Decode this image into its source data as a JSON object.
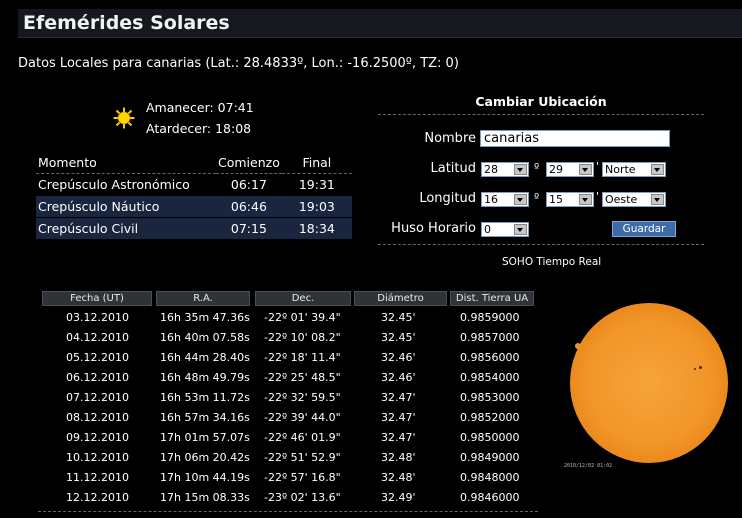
{
  "title": "Efemérides Solares",
  "location_line": "Datos Locales para canarias (Lat.: 28.4833º, Lon.: -16.2500º, TZ: 0)",
  "sun": {
    "sunrise": "Amanecer: 07:41",
    "sunset": "Atardecer: 18:08",
    "icon": "sun-icon"
  },
  "twilight": {
    "headers": [
      "Momento",
      "Comienzo",
      "Final"
    ],
    "rows": [
      {
        "name": "Crepúsculo Astronómico",
        "start": "06:17",
        "end": "19:31"
      },
      {
        "name": "Crepúsculo Náutico",
        "start": "06:46",
        "end": "19:03"
      },
      {
        "name": "Crepúsculo Civil",
        "start": "07:15",
        "end": "18:34"
      }
    ]
  },
  "location_form": {
    "title": "Cambiar Ubicación",
    "name_label": "Nombre",
    "name_value": "canarias",
    "lat_label": "Latitud",
    "lat_deg": "28",
    "lat_min": "29",
    "lat_dir": "Norte",
    "lon_label": "Longitud",
    "lon_deg": "16",
    "lon_min": "15",
    "lon_dir": "Oeste",
    "tz_label": "Huso Horario",
    "tz_value": "0",
    "deg_symbol": "º",
    "min_symbol": "'",
    "save_label": "Guardar"
  },
  "soho": {
    "label": "SOHO Tiempo Real",
    "timestamp": "2010/12/02 01:02"
  },
  "ephemeris": {
    "headers": [
      "Fecha (UT)",
      "R.A.",
      "Dec.",
      "Diámetro",
      "Dist. Tierra UA"
    ],
    "rows": [
      [
        "03.12.2010",
        "16h 35m 47.36s",
        "-22º 01' 39.4\"",
        "32.45'",
        "0.9859000"
      ],
      [
        "04.12.2010",
        "16h 40m 07.58s",
        "-22º 10' 08.2\"",
        "32.45'",
        "0.9857000"
      ],
      [
        "05.12.2010",
        "16h 44m 28.40s",
        "-22º 18' 11.4\"",
        "32.46'",
        "0.9856000"
      ],
      [
        "06.12.2010",
        "16h 48m 49.79s",
        "-22º 25' 48.5\"",
        "32.46'",
        "0.9854000"
      ],
      [
        "07.12.2010",
        "16h 53m 11.72s",
        "-22º 32' 59.5\"",
        "32.47'",
        "0.9853000"
      ],
      [
        "08.12.2010",
        "16h 57m 34.16s",
        "-22º 39' 44.0\"",
        "32.47'",
        "0.9852000"
      ],
      [
        "09.12.2010",
        "17h 01m 57.07s",
        "-22º 46' 01.9\"",
        "32.47'",
        "0.9850000"
      ],
      [
        "10.12.2010",
        "17h 06m 20.42s",
        "-22º 51' 52.9\"",
        "32.48'",
        "0.9849000"
      ],
      [
        "11.12.2010",
        "17h 10m 44.19s",
        "-22º 57' 16.8\"",
        "32.48'",
        "0.9848000"
      ],
      [
        "12.12.2010",
        "17h 15m 08.33s",
        "-23º 02' 13.6\"",
        "32.49'",
        "0.9846000"
      ]
    ]
  }
}
